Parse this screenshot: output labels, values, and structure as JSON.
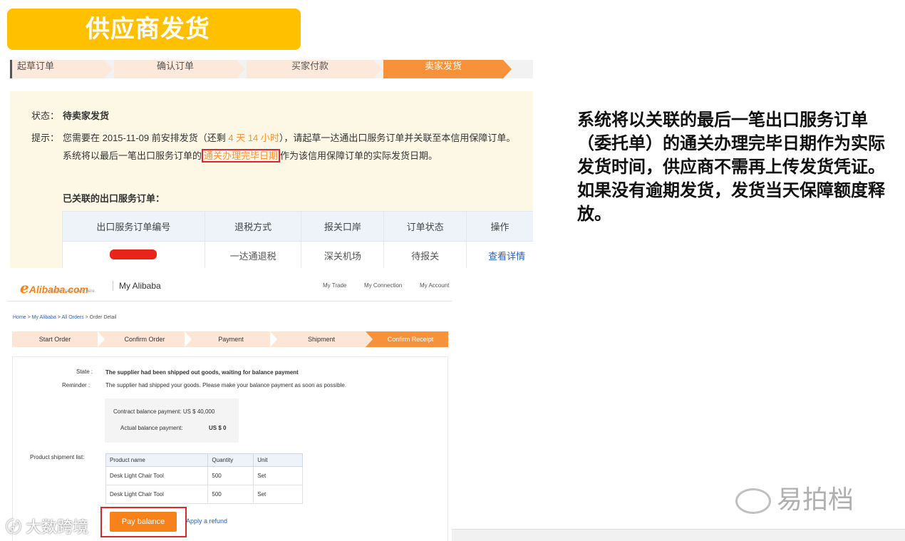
{
  "slide": {
    "title": "供应商发货",
    "description": "系统将以关联的最后一笔出口服务订单（委托单）的通关办理完毕日期作为实际发货时间，供应商不需再上传发货凭证。如果没有逾期发货，发货当天保障额度释放。",
    "watermark_right": "易拍档",
    "watermark_left": "大数跨境"
  },
  "order_cn": {
    "steps": [
      "起草订单",
      "确认订单",
      "买家付款",
      "卖家发货"
    ],
    "active_step": 3,
    "status_label": "状态：",
    "status_value": "待卖家发货",
    "tip_label": "提示：",
    "tip_pre": "您需要在 2015-11-09 前安排发货（还剩 ",
    "tip_remaining": "4 天 14 小时",
    "tip_post": "），请起草一达通出口服务订单并关联至本信用保障订单。",
    "tip2_pre": "系统将以最后一笔出口服务订单的",
    "tip2_highlight": "通关办理完毕日期",
    "tip2_post": "作为该信用保障订单的实际发货日期。",
    "linked_title": "已关联的出口服务订单：",
    "table_headers": [
      "出口服务订单编号",
      "退税方式",
      "报关口岸",
      "订单状态",
      "操作"
    ],
    "table_row": {
      "refund": "一达通退税",
      "port": "深关机场",
      "status": "待报关",
      "action": "查看详情"
    }
  },
  "order_en": {
    "logo": "Alibaba.com",
    "logo_tagline": "Global trade starts here.",
    "my_alibaba": "My Alibaba",
    "nav": [
      "My Trade",
      "My Connection",
      "My Account"
    ],
    "breadcrumb": [
      "Home",
      "My Alibaba",
      "All Orders",
      "Order Detail"
    ],
    "steps": [
      "Start Order",
      "Confirm Order",
      "Payment",
      "Shipment",
      "Confirm Receipt"
    ],
    "active_step": 4,
    "state_label": "State :",
    "state_value": "The supplier had been shipped out goods, waiting for balance payment",
    "reminder_label": "Reminder :",
    "reminder_value": "The supplier had shipped your goods. Please make your balance payment as soon as possible.",
    "contract_balance": "Contract balance payment: US $ 40,000",
    "actual_label": "Actual balance payment:",
    "actual_value": "US $ 0",
    "shipment_label": "Product shipment list:",
    "table_headers": [
      "Product name",
      "Quantity",
      "Unit"
    ],
    "rows": [
      {
        "name": "Desk Light Chair Tool",
        "qty": "500",
        "unit": "Set"
      },
      {
        "name": "Desk Light Chair Tool",
        "qty": "500",
        "unit": "Set"
      }
    ],
    "pay_button": "Pay balance",
    "refund_link": "Apply a refund"
  },
  "colors": {
    "title_bg": "#ffc000",
    "accent": "#f7923a",
    "highlight_box": "#d9282f"
  }
}
